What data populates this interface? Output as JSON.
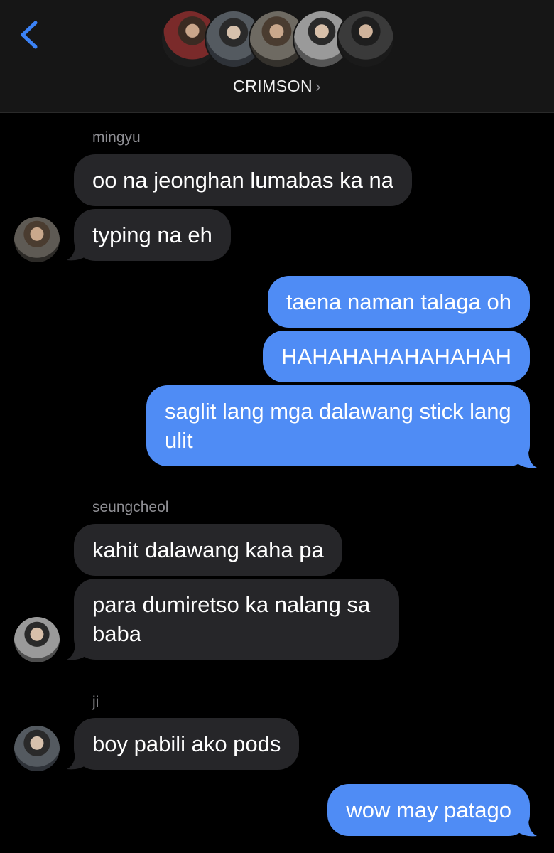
{
  "header": {
    "title": "CRIMSON",
    "chevron": "›",
    "back_icon": "chevron-left-icon"
  },
  "messages": [
    {
      "sender": "mingyu",
      "texts": [
        "oo na jeonghan lumabas ka na",
        "typing na eh"
      ]
    },
    {
      "sender": "me",
      "texts": [
        "taena naman talaga oh",
        "HAHAHAHAHAHAHAH",
        "saglit lang mga dalawang stick lang ulit"
      ]
    },
    {
      "sender": "seungcheol",
      "texts": [
        "kahit dalawang kaha pa",
        "para dumiretso ka nalang sa baba"
      ]
    },
    {
      "sender": "ji",
      "texts": [
        "boy pabili ako pods"
      ]
    },
    {
      "sender": "me",
      "texts": [
        "wow may patago"
      ]
    }
  ],
  "colors": {
    "background": "#000000",
    "header": "#161616",
    "incoming_bubble": "#262629",
    "outgoing_bubble": "#4f8cf5",
    "accent": "#3b82f6"
  }
}
